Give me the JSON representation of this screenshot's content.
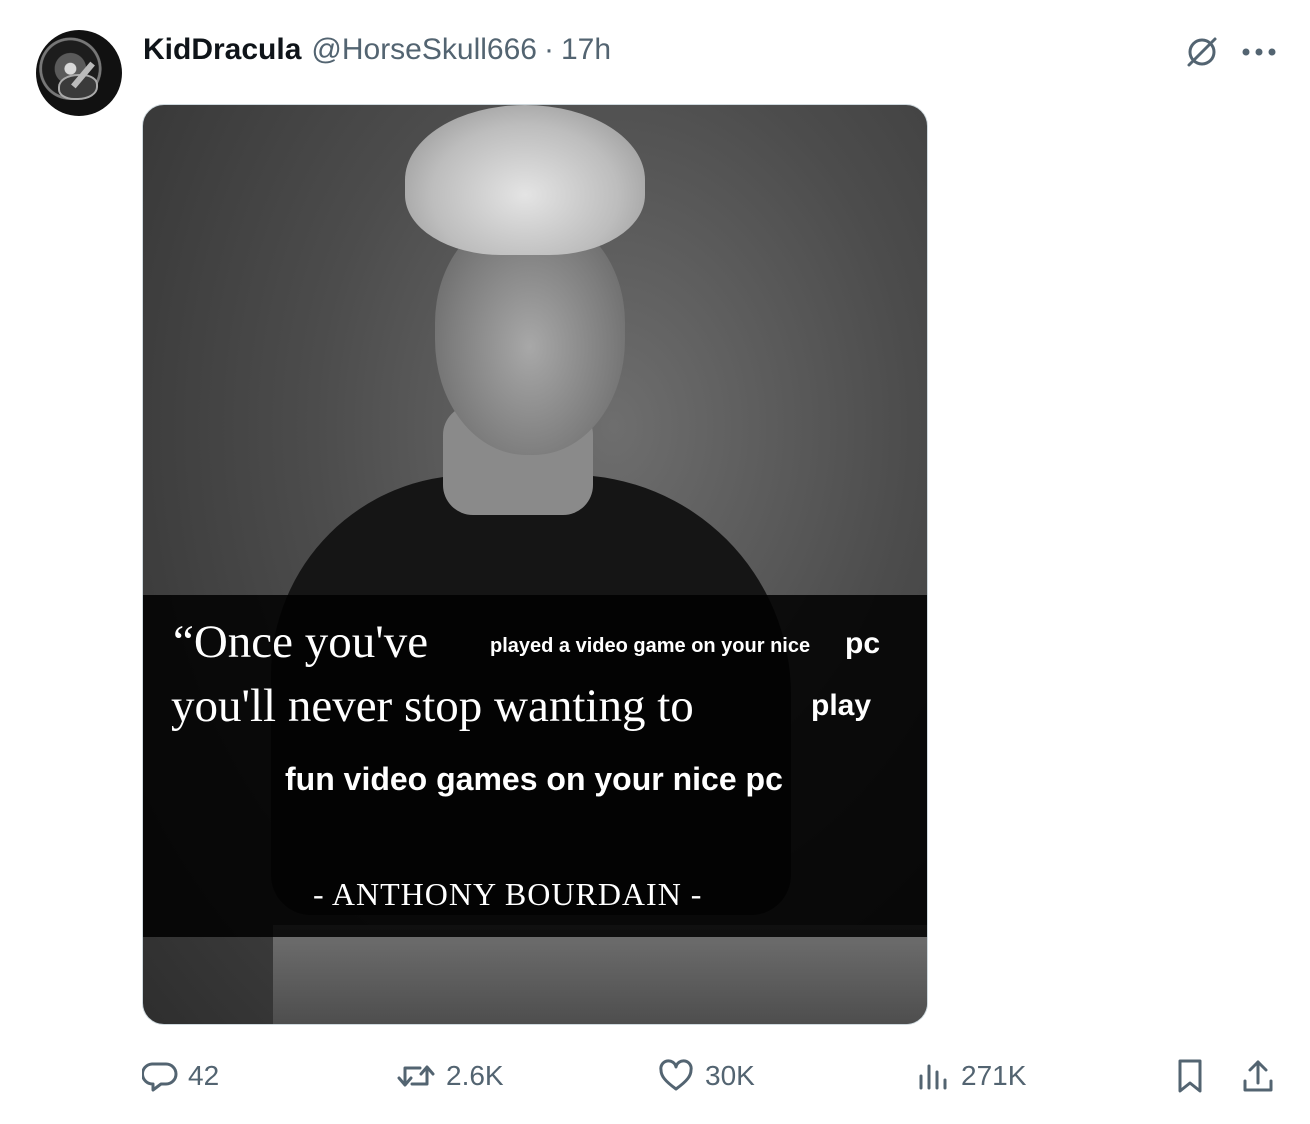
{
  "post": {
    "display_name": "KidDracula",
    "handle": "@HorseSkull666",
    "separator": "·",
    "time": "17h"
  },
  "media": {
    "quote_line1_serif": "“Once you've",
    "quote_line1_sans": "played a video game on your nice",
    "quote_line1_pc": "pc",
    "quote_line2_serif": "you'll never stop wanting to",
    "quote_line2_sans": "play",
    "quote_line3": "fun video games on your nice pc",
    "author": "-  ANTHONY BOURDAIN  -"
  },
  "actions": {
    "replies": "42",
    "reposts": "2.6K",
    "likes": "30K",
    "views": "271K"
  },
  "icons": {
    "grok": "grok-icon",
    "more": "more-icon",
    "reply": "reply-icon",
    "repost": "repost-icon",
    "like": "heart-icon",
    "views": "views-icon",
    "bookmark": "bookmark-icon",
    "share": "share-icon"
  },
  "colors": {
    "text_primary": "#0f1419",
    "text_secondary": "#536471"
  }
}
